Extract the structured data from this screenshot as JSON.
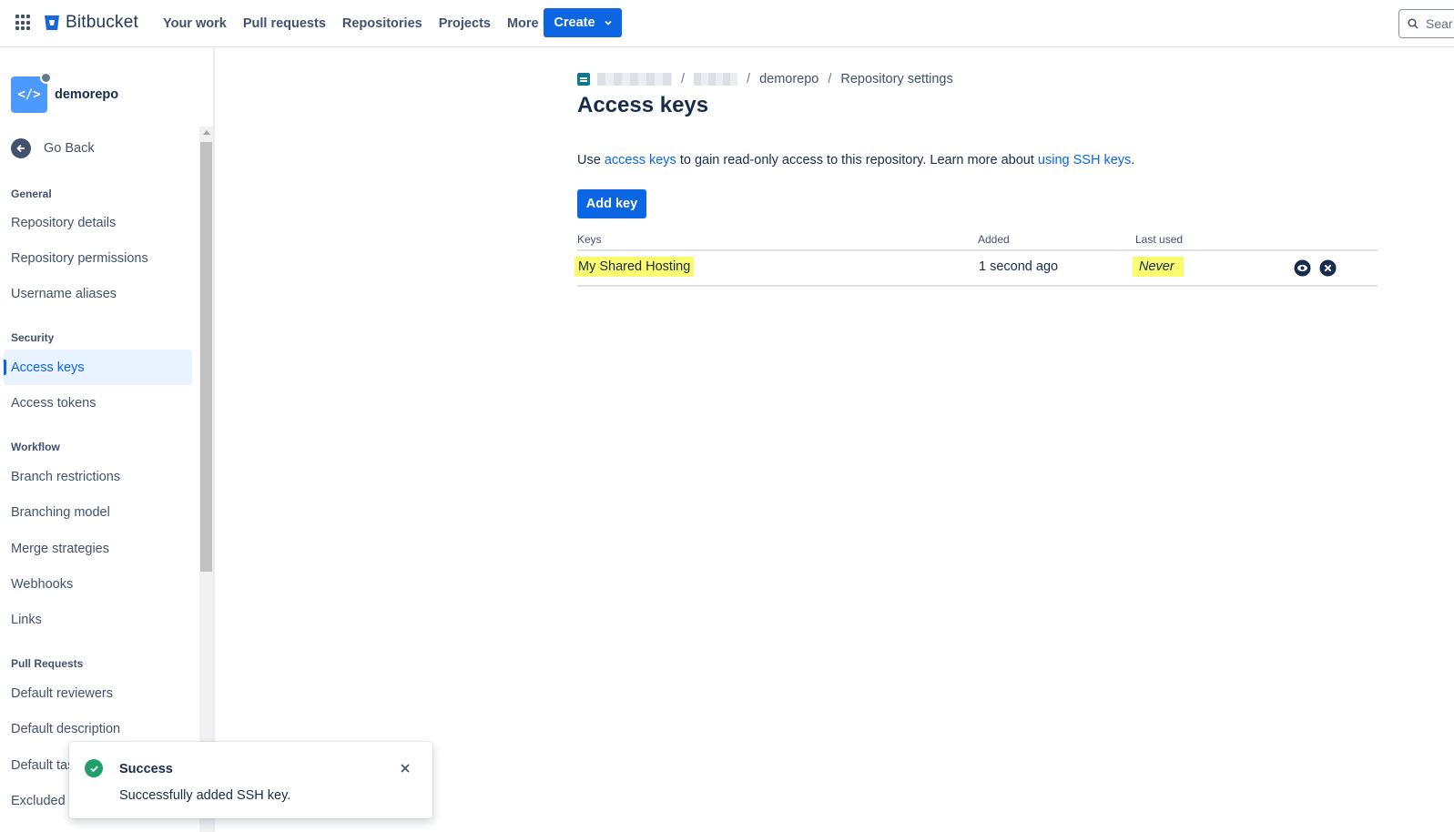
{
  "brand": {
    "name": "Bitbucket",
    "accent": "#0c66e4"
  },
  "topnav": {
    "items": [
      {
        "label": "Your work"
      },
      {
        "label": "Pull requests"
      },
      {
        "label": "Repositories"
      },
      {
        "label": "Projects"
      },
      {
        "label": "More"
      }
    ],
    "create_label": "Create",
    "search_placeholder": "Sear"
  },
  "sidebar": {
    "repo_name": "demorepo",
    "repo_icon_text": "</>",
    "go_back": "Go Back",
    "sections": {
      "general": "General",
      "security": "Security",
      "workflow": "Workflow",
      "pull_requests": "Pull Requests"
    },
    "items": {
      "repository_details": "Repository details",
      "repository_permissions": "Repository permissions",
      "username_aliases": "Username aliases",
      "access_keys": "Access keys",
      "access_tokens": "Access tokens",
      "branch_restrictions": "Branch restrictions",
      "branching_model": "Branching model",
      "merge_strategies": "Merge strategies",
      "webhooks": "Webhooks",
      "links": "Links",
      "default_reviewers": "Default reviewers",
      "default_description": "Default description",
      "default_tasks": "Default tasks",
      "excluded_files": "Excluded files"
    }
  },
  "breadcrumb": {
    "repo": "demorepo",
    "page": "Repository settings",
    "separator": "/"
  },
  "page": {
    "title": "Access keys",
    "desc_prefix": "Use ",
    "desc_link1": "access keys",
    "desc_middle": " to gain read-only access to this repository. Learn more about ",
    "desc_link2": "using SSH keys",
    "desc_suffix": ".",
    "add_key": "Add key"
  },
  "table": {
    "columns": [
      "Keys",
      "Added",
      "Last used"
    ],
    "rows": [
      {
        "key": "My Shared Hosting",
        "added": "1 second ago",
        "last_used": "Never"
      }
    ]
  },
  "toast": {
    "title": "Success",
    "message": "Successfully added SSH key.",
    "status_color": "#22a06b"
  }
}
